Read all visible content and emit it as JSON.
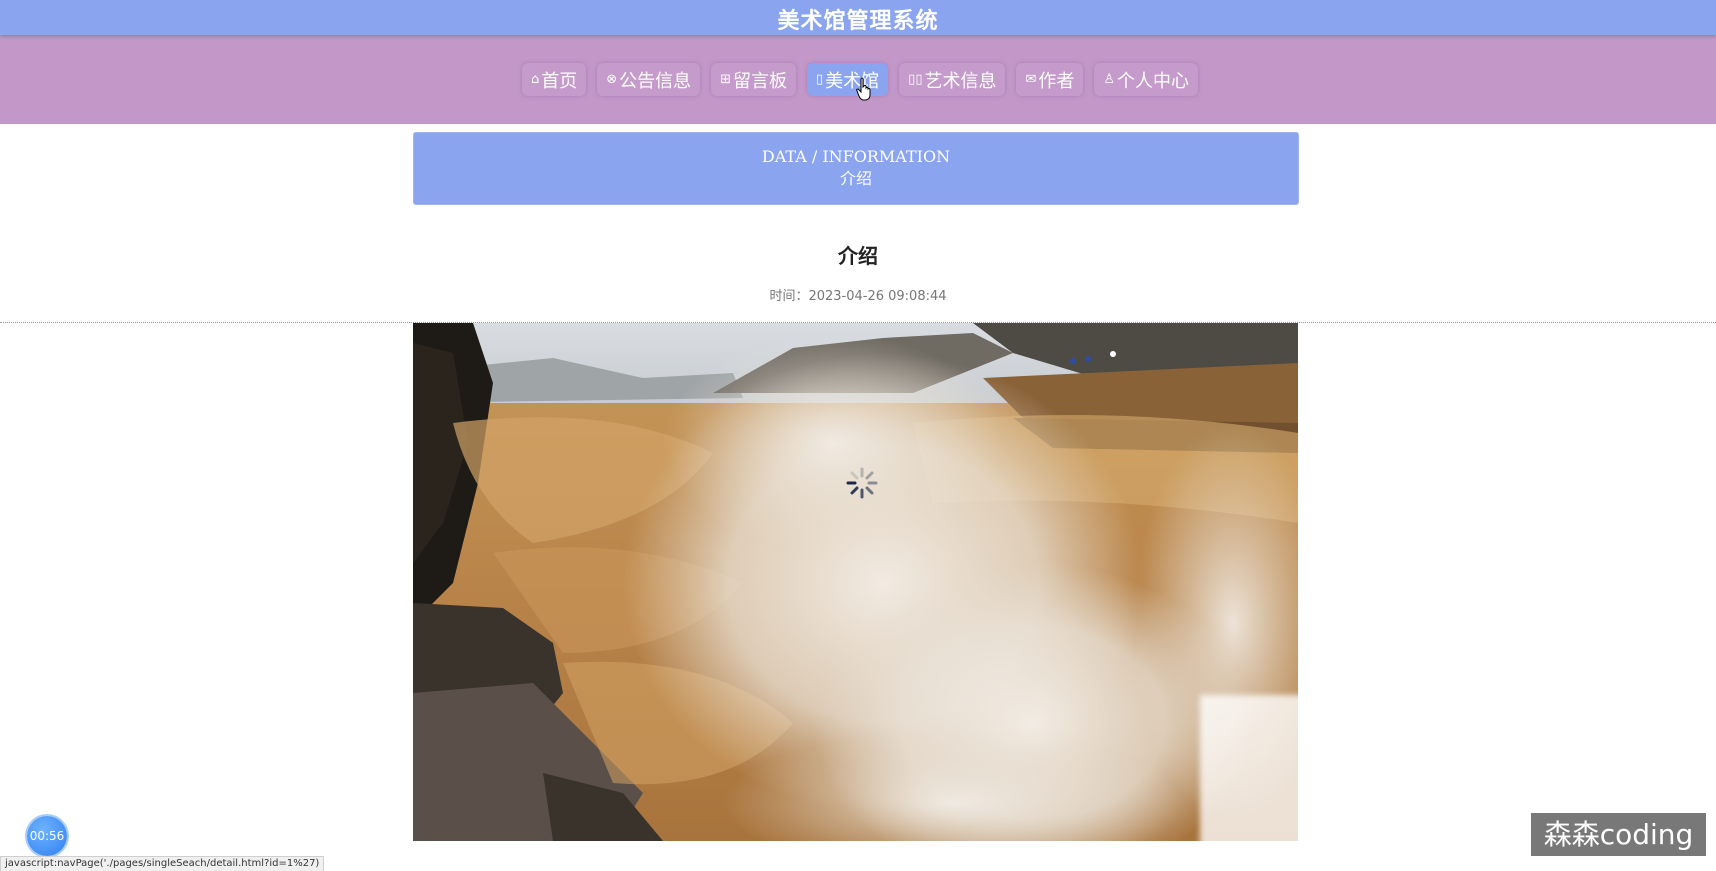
{
  "app": {
    "title": "美术馆管理系统"
  },
  "nav": {
    "items": [
      {
        "label": "首页",
        "icon": "home-icon",
        "glyph": "⌂"
      },
      {
        "label": "公告信息",
        "icon": "announcement-icon",
        "glyph": "⊗"
      },
      {
        "label": "留言板",
        "icon": "grid-icon",
        "glyph": "⊞"
      },
      {
        "label": "美术馆",
        "icon": "page-icon",
        "glyph": "▯",
        "active": true
      },
      {
        "label": "艺术信息",
        "icon": "book-icon",
        "glyph": "▯▯"
      },
      {
        "label": "作者",
        "icon": "mail-icon",
        "glyph": "✉"
      },
      {
        "label": "个人中心",
        "icon": "user-icon",
        "glyph": "♙"
      }
    ]
  },
  "banner": {
    "en": "DATA / INFORMATION",
    "cn": "介绍"
  },
  "article": {
    "title": "介绍",
    "time": "时间：2023-04-26 09:08:44"
  },
  "overlay": {
    "timer": "00:56",
    "status_url": "javascript:navPage('./pages/singleSeach/detail.html?id=1%27)",
    "watermark": "森森coding"
  },
  "colors": {
    "header": "#8aa4f0",
    "nav": "#c398c9",
    "active_tab": "#8aa4f0",
    "banner": "#8aa4f0"
  }
}
